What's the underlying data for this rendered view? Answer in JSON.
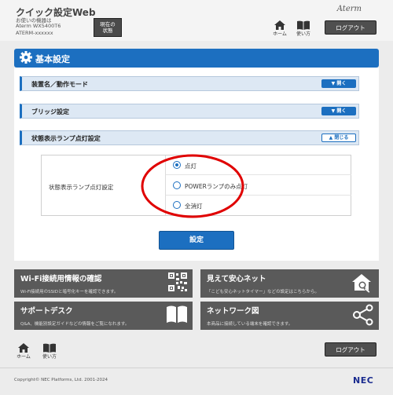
{
  "header": {
    "title": "クイック設定Web",
    "device_lines": [
      "お使いの機器は",
      "Aterm WX5400T6",
      "ATERM-xxxxxx"
    ],
    "status_button": [
      "現在の",
      "状態"
    ],
    "brand": "Aterm",
    "home_label": "ホーム",
    "help_label": "使い方",
    "logout_label": "ログアウト"
  },
  "panel": {
    "title": "基本設定",
    "sections": [
      {
        "label": "装置名／動作モード",
        "button": "開く"
      },
      {
        "label": "ブリッジ設定",
        "button": "開く"
      },
      {
        "label": "状態表示ランプ点灯設定",
        "button": "閉じる"
      }
    ],
    "setting_label": "状態表示ランプ点灯設定",
    "options": [
      {
        "label": "点灯",
        "selected": true
      },
      {
        "label": "POWERランプのみ点灯",
        "selected": false
      },
      {
        "label": "全消灯",
        "selected": false
      }
    ],
    "apply_label": "設定"
  },
  "cards": [
    {
      "title": "Wi-Fi接続用情報の確認",
      "desc": "Wi-Fi接続用のSSIDと暗号化キーを確認できます。",
      "icon": "qr-code-icon"
    },
    {
      "title": "見えて安心ネット",
      "desc": "「こども安心ネットタイマー」などの設定はこちらから。",
      "icon": "house-search-icon"
    },
    {
      "title": "サポートデスク",
      "desc": "Q&A、機能別設定ガイドなどの情報をご覧になれます。",
      "icon": "book-icon"
    },
    {
      "title": "ネットワーク図",
      "desc": "本商品に接続している端末を確認できます。",
      "icon": "network-icon"
    }
  ],
  "footer": {
    "home_label": "ホーム",
    "help_label": "使い方",
    "logout_label": "ログアウト",
    "copyright": "Copyright© NEC Platforms, Ltd. 2001-2024",
    "logo": "NEC"
  },
  "colors": {
    "accent": "#1c6fc0",
    "annotation": "#e00000",
    "card": "#5a5a5a"
  }
}
